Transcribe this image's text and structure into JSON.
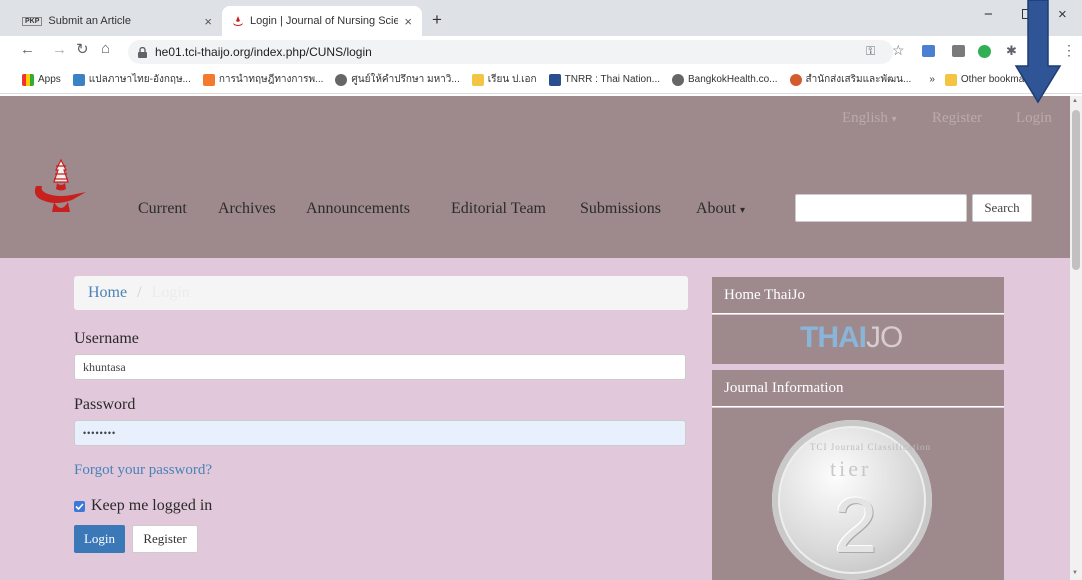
{
  "browser": {
    "tabs": [
      {
        "favicon": "PKP",
        "title": "Submit an Article",
        "close": "×"
      },
      {
        "title": "Login | Journal of Nursing Scienc",
        "close": "×"
      }
    ],
    "new_tab": "+",
    "window": {
      "minimize": "−",
      "close": "×"
    },
    "url": "he01.tci-thaijo.org/index.php/CUNS/login",
    "bookmarks": [
      "Apps",
      "แปลภาษาไทย-อังกฤษ...",
      "การนำทฤษฎีทางการพ...",
      "ศูนย์ให้คำปรึกษา มหาวิ...",
      "เรียน ป.เอก",
      "TNRR : Thai Nation...",
      "BangkokHealth.co...",
      "สำนักส่งเสริมและพัฒน..."
    ],
    "bookmarks_more": "»",
    "other_bookmarks": "Other bookmarks"
  },
  "header": {
    "lang": "English",
    "register": "Register",
    "login": "Login",
    "nav": [
      "Current",
      "Archives",
      "Announcements",
      "Editorial Team",
      "Submissions",
      "About"
    ],
    "search_button": "Search"
  },
  "breadcrumb": {
    "home": "Home",
    "sep": "/",
    "current": "Login"
  },
  "form": {
    "username_label": "Username",
    "username_value": "khuntasa",
    "password_label": "Password",
    "password_value": "••••••••",
    "forgot": "Forgot your password?",
    "keep": "Keep me logged in",
    "login_button": "Login",
    "register_button": "Register"
  },
  "sidebar": {
    "home_thaijo": "Home ThaiJo",
    "logo_a": "THAI",
    "logo_b": "JO",
    "journal_info": "Journal Information",
    "badge_ring": "TCI Journal Classification",
    "badge_tier": "tier",
    "badge_num": "2"
  },
  "colors": {
    "header": "#9e8a8d",
    "content": "#e1c8db",
    "link": "#4a82b8",
    "arrow": "#2f5597"
  }
}
